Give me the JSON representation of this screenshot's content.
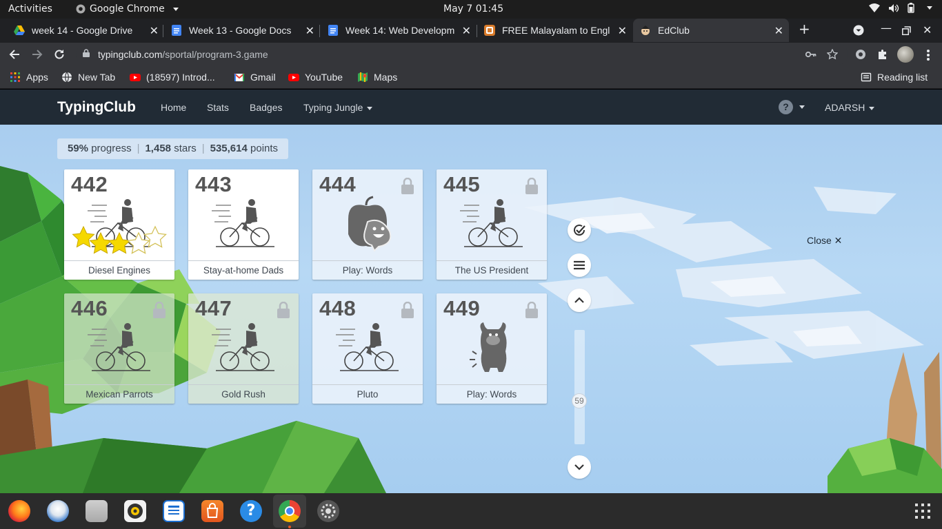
{
  "system": {
    "activities": "Activities",
    "app_name": "Google Chrome",
    "clock": "May 7  01:45"
  },
  "tabs": [
    {
      "label": "week 14 - Google Drive",
      "icon": "drive-icon"
    },
    {
      "label": "Week 13 - Google Docs",
      "icon": "docs-icon"
    },
    {
      "label": "Week 14: Web Developm",
      "icon": "docs-icon"
    },
    {
      "label": "FREE Malayalam to Engl",
      "icon": "translate-icon"
    },
    {
      "label": "EdClub",
      "icon": "edclub-icon",
      "active": true
    }
  ],
  "address": {
    "host": "typingclub.com",
    "path": "/sportal/program-3.game"
  },
  "bookmarks": [
    {
      "label": "Apps"
    },
    {
      "label": "New Tab"
    },
    {
      "label": "(18597) Introd..."
    },
    {
      "label": "Gmail"
    },
    {
      "label": "YouTube"
    },
    {
      "label": "Maps"
    }
  ],
  "reading_list": "Reading list",
  "site": {
    "logo": "TypingClub",
    "nav": [
      "Home",
      "Stats",
      "Badges",
      "Typing Jungle"
    ],
    "help": "?",
    "user": "ADARSH"
  },
  "stats": {
    "progress_value": "59%",
    "progress_label": "progress",
    "stars_value": "1,458",
    "stars_label": "stars",
    "points_value": "535,614",
    "points_label": "points"
  },
  "lessons": [
    {
      "number": "442",
      "title": "Diesel Engines",
      "locked": false,
      "art": "cyclist",
      "stars": 3
    },
    {
      "number": "443",
      "title": "Stay-at-home Dads",
      "locked": false,
      "art": "cyclist"
    },
    {
      "number": "444",
      "title": "Play: Words",
      "locked": true,
      "art": "apple-game"
    },
    {
      "number": "445",
      "title": "The US President",
      "locked": true,
      "art": "cyclist"
    },
    {
      "number": "446",
      "title": "Mexican Parrots",
      "locked": true,
      "art": "cyclist"
    },
    {
      "number": "447",
      "title": "Gold Rush",
      "locked": true,
      "art": "cyclist"
    },
    {
      "number": "448",
      "title": "Pluto",
      "locked": true,
      "art": "cyclist"
    },
    {
      "number": "449",
      "title": "Play: Words",
      "locked": true,
      "art": "monster-game"
    }
  ],
  "scroll_position": "59",
  "close_label": "Close ✕",
  "colors": {
    "header_bg": "#212b35",
    "sky": "#a9cdef",
    "star": "#f5d800"
  }
}
